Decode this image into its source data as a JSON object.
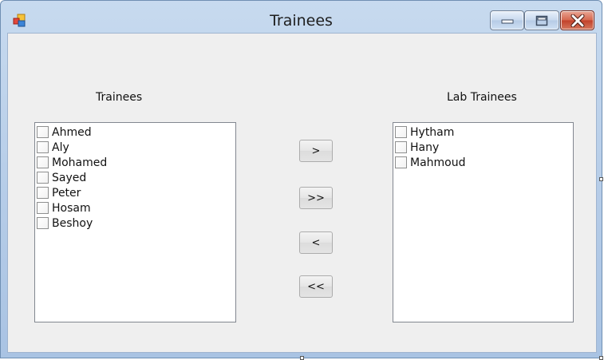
{
  "window": {
    "title": "Trainees"
  },
  "left_panel": {
    "label": "Trainees",
    "items": [
      "Ahmed",
      "Aly",
      "Mohamed",
      "Sayed",
      "Peter",
      "Hosam",
      "Beshoy"
    ]
  },
  "right_panel": {
    "label": "Lab Trainees",
    "items": [
      "Hytham",
      "Hany",
      "Mahmoud"
    ]
  },
  "buttons": {
    "move_selected_right": ">",
    "move_all_right": ">>",
    "move_selected_left": "<",
    "move_all_left": "<<"
  }
}
